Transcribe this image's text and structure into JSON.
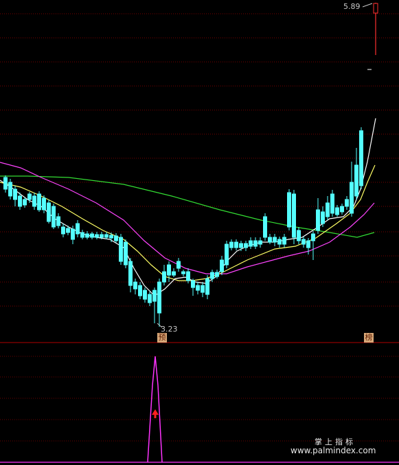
{
  "price_panel": {
    "high_price_label": "5.89",
    "low_price_label": "3.23",
    "signal_badge_left": "预",
    "signal_badge_right": "榜"
  },
  "watermark": {
    "brand_cn": "掌上指标",
    "url": "www.palmindex.com"
  },
  "colors": {
    "background": "#000000",
    "up_candle": "#ff3030",
    "down_candle": "#54ffff",
    "ma_short": "#ffffff",
    "ma_mid": "#ffff66",
    "ma_long": "#ff44ff",
    "ma_very_long": "#33dd33",
    "indicator_line": "#ff33ff",
    "signal_arrow": "#ff2020",
    "grid": "#8b0000"
  }
}
